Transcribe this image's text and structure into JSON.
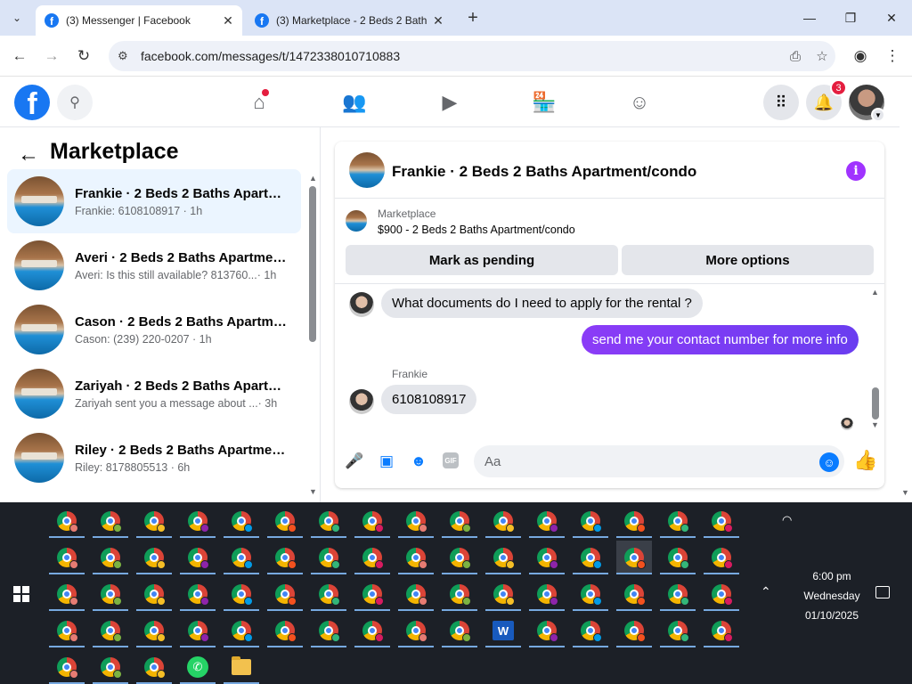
{
  "browser": {
    "tabs": [
      {
        "title": "(3) Messenger | Facebook",
        "active": true
      },
      {
        "title": "(3) Marketplace - 2 Beds 2 Bath",
        "active": false
      }
    ],
    "url": "facebook.com/messages/t/1472338010710883"
  },
  "fb_header": {
    "logo_letter": "f",
    "notification_count": "3"
  },
  "left_panel": {
    "title": "Marketplace",
    "conversations": [
      {
        "name": "Frankie · 2 Beds 2 Baths Apartm...",
        "preview": "Frankie: 6108108917 · 1h",
        "time": "",
        "active": true
      },
      {
        "name": "Averi · 2 Beds 2 Baths Apartmen...",
        "preview": "Averi: Is this still available? 813760...",
        "time": " · 1h",
        "active": false
      },
      {
        "name": "Cason · 2 Beds 2 Baths Apartme...",
        "preview": "Cason: (239) 220-0207 · 1h",
        "time": "",
        "active": false
      },
      {
        "name": "Zariyah · 2 Beds 2 Baths Apartm...",
        "preview": "Zariyah sent you a message about ...",
        "time": " · 3h",
        "active": false
      },
      {
        "name": "Riley · 2 Beds 2 Baths Apartmen...",
        "preview": "Riley: 8178805513 · 6h",
        "time": "",
        "active": false
      }
    ]
  },
  "chat": {
    "title": "Frankie · 2 Beds 2 Baths Apartment/condo",
    "marketplace_label": "Marketplace",
    "listing": "$900 - 2 Beds 2 Baths Apartment/condo",
    "mark_pending_label": "Mark as pending",
    "more_options_label": "More options",
    "messages": {
      "incoming_1": "What documents do I need to apply for the rental ?",
      "outgoing_1": "send me your contact number for more info",
      "sender_name": "Frankie",
      "incoming_2": "6108108917"
    },
    "composer_placeholder": "Aa",
    "accent_color": "#0a7cff",
    "outgoing_bubble_color": "#7a3cf0"
  },
  "taskbar": {
    "time": "6:00 pm",
    "day": "Wednesday",
    "date": "01/10/2025"
  }
}
